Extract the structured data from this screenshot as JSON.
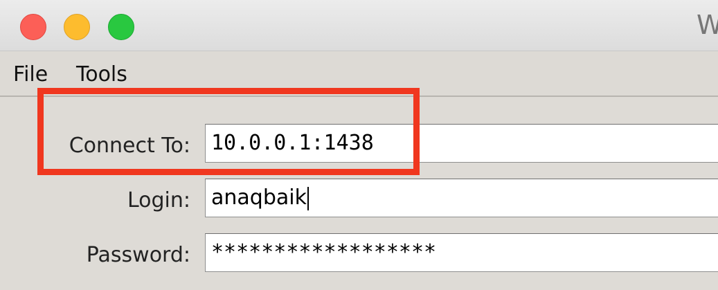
{
  "window": {
    "title": "W",
    "colors": {
      "close": "#fc5f57",
      "minimize": "#fdbc2e",
      "maximize": "#29c840",
      "highlight": "#f0371f"
    }
  },
  "menu": {
    "items": [
      {
        "label": "File"
      },
      {
        "label": "Tools"
      }
    ]
  },
  "form": {
    "connect_to": {
      "label": "Connect To:",
      "value": "10.0.0.1:1438"
    },
    "login": {
      "label": "Login:",
      "value": "anaqbaik"
    },
    "password": {
      "label": "Password:",
      "value": "******************"
    }
  },
  "icons": {
    "close": "close-traffic-light-icon",
    "minimize": "minimize-traffic-light-icon",
    "maximize": "maximize-traffic-light-icon"
  }
}
